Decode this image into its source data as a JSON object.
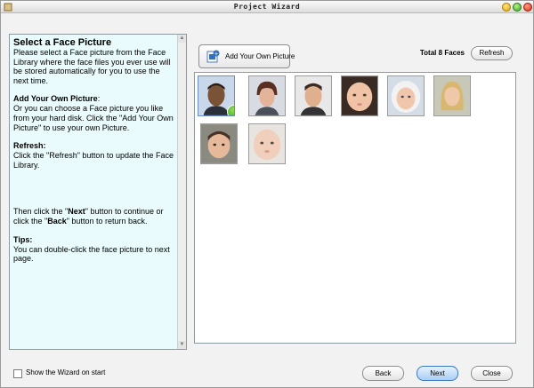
{
  "window": {
    "title": "Project Wizard"
  },
  "help": {
    "heading": "Select a Face Picture",
    "intro": "Please select a Face picture from the Face Library where the face files you ever use will be stored automatically for you to use the next time.",
    "add_title": "Add Your Own Picture",
    "add_colon": ":",
    "add_text": "Or you can choose a Face picture you like from your hard disk. Click the \"Add Your Own Picture\" to use your own Picture.",
    "refresh_title": "Refresh:",
    "refresh_text": "Click the \"Refresh\" button to update the Face Library.",
    "nav_part1": "Then click the \"",
    "nav_next": "Next",
    "nav_part2": "\" button to continue or click the \"",
    "nav_back": "Back",
    "nav_part3": "\" button to return back.",
    "tips_title": "Tips:",
    "tips_text": "You can double-click the face picture to next page."
  },
  "toolbar": {
    "add_label": "Add Your Own Picture",
    "total_prefix": "Total",
    "total_count": "8",
    "total_unit": "Faces",
    "refresh_label": "Refresh"
  },
  "faces": [
    {
      "icon": "adult-man-dark-face",
      "selected": true
    },
    {
      "icon": "adult-woman-short-hair-face",
      "selected": false
    },
    {
      "icon": "adult-man-face",
      "selected": false
    },
    {
      "icon": "baby-face",
      "selected": false
    },
    {
      "icon": "baby-hooded-face",
      "selected": false
    },
    {
      "icon": "blonde-woman-face",
      "selected": false
    },
    {
      "icon": "child-face",
      "selected": false
    },
    {
      "icon": "infant-face",
      "selected": false
    }
  ],
  "footer": {
    "show_wizard_label": "Show the Wizard on start",
    "show_wizard_checked": false,
    "back_label": "Back",
    "next_label": "Next",
    "close_label": "Close"
  },
  "colors": {
    "help_bg": "#e9fbfc",
    "next_accent": "#3b79c5",
    "check_green": "#2f9a16"
  }
}
